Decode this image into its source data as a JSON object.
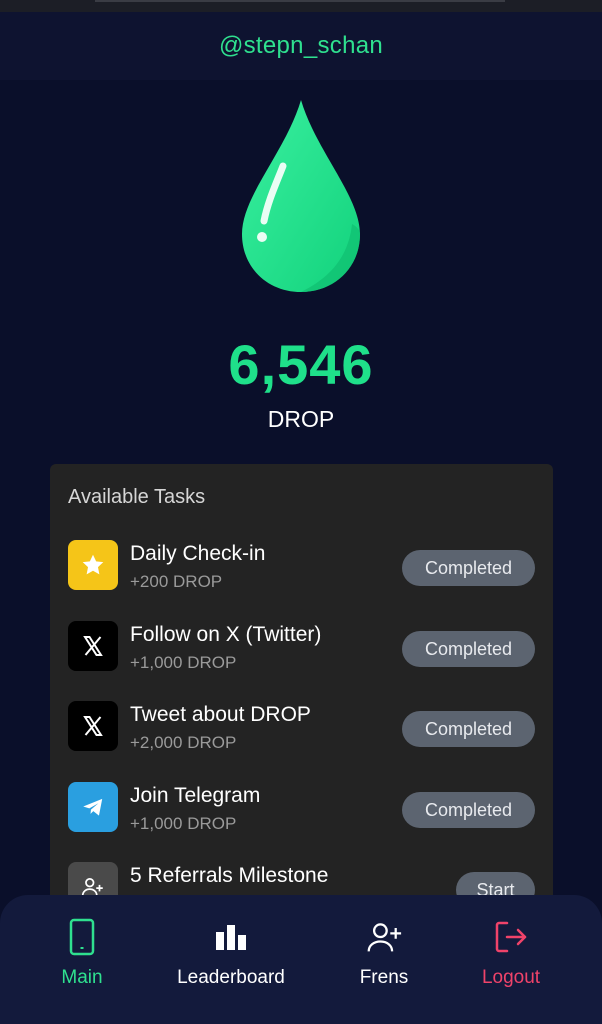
{
  "header": {
    "username": "@stepn_schan"
  },
  "balance": {
    "amount": "6,546",
    "unit": "DROP"
  },
  "tasks": {
    "title": "Available Tasks",
    "items": [
      {
        "name": "Daily Check-in",
        "reward": "+200 DROP",
        "status": "Completed",
        "icon": "star-icon",
        "icon_bg": "#f5c518"
      },
      {
        "name": "Follow on X (Twitter)",
        "reward": "+1,000 DROP",
        "status": "Completed",
        "icon": "x-logo-icon",
        "icon_bg": "#000000"
      },
      {
        "name": "Tweet about DROP",
        "reward": "+2,000 DROP",
        "status": "Completed",
        "icon": "x-logo-icon",
        "icon_bg": "#000000"
      },
      {
        "name": "Join Telegram",
        "reward": "+1,000 DROP",
        "status": "Completed",
        "icon": "telegram-icon",
        "icon_bg": "#2a9fe0"
      },
      {
        "name": "5 Referrals Milestone",
        "reward": "",
        "status": "Start",
        "icon": "referral-icon",
        "icon_bg": "#4a4a4a"
      }
    ]
  },
  "nav": {
    "items": [
      {
        "label": "Main",
        "icon": "phone-icon",
        "color": "#2fe08f",
        "active": true
      },
      {
        "label": "Leaderboard",
        "icon": "bar-chart-icon",
        "color": "#ffffff",
        "active": false
      },
      {
        "label": "Frens",
        "icon": "add-user-icon",
        "color": "#ffffff",
        "active": false
      },
      {
        "label": "Logout",
        "icon": "logout-icon",
        "color": "#f0436a",
        "active": false
      }
    ]
  },
  "colors": {
    "accent": "#1fe08a",
    "background": "#0a0f2a",
    "card": "#232323",
    "danger": "#f0436a"
  }
}
